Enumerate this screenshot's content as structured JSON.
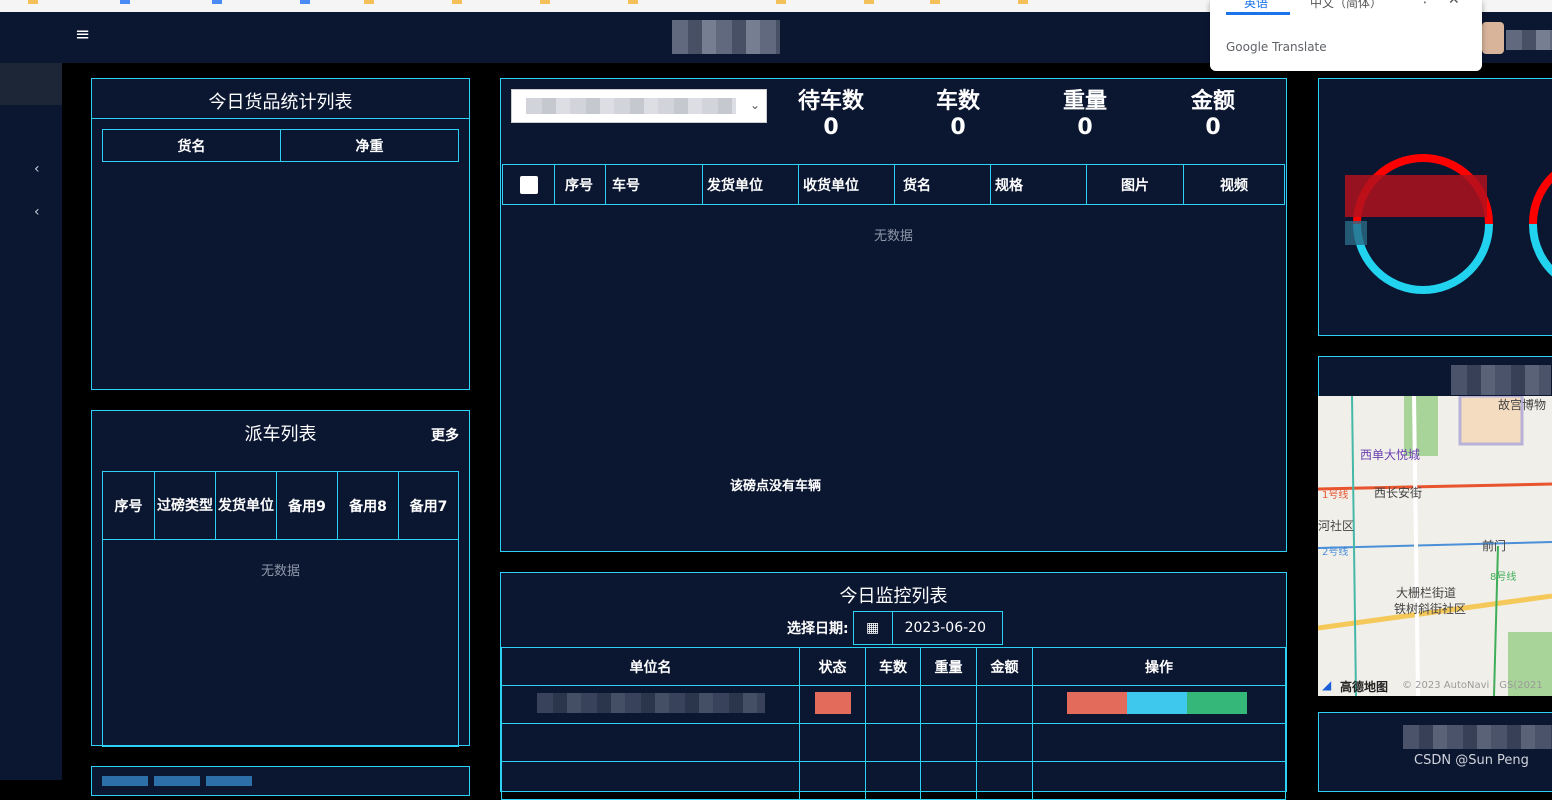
{
  "translate_popup": {
    "tab_english": "英语",
    "tab_chinese": "中文（简体）",
    "brand_google": "Google",
    "brand_translate": "Translate"
  },
  "goods_panel": {
    "title": "今日货品统计列表",
    "columns": [
      "货名",
      "净重"
    ]
  },
  "dispatch_panel": {
    "title": "派车列表",
    "more_link": "更多",
    "columns": [
      "序号",
      "过磅类型",
      "发货单位",
      "备用9",
      "备用8",
      "备用7"
    ],
    "empty_text": "无数据"
  },
  "vehicle_panel": {
    "stats": [
      {
        "label": "待车数",
        "value": "0"
      },
      {
        "label": "车数",
        "value": "0"
      },
      {
        "label": "重量",
        "value": "0"
      },
      {
        "label": "金额",
        "value": "0"
      }
    ],
    "columns": [
      "序号",
      "车号",
      "发货单位",
      "收货单位",
      "货名",
      "规格",
      "图片",
      "视频"
    ],
    "empty_text": "无数据",
    "no_vehicle_text": "该磅点没有车辆"
  },
  "monitor_panel": {
    "title": "今日监控列表",
    "date_label": "选择日期:",
    "date_value": "2023-06-20",
    "columns": [
      "单位名",
      "状态",
      "车数",
      "重量",
      "金额",
      "操作"
    ]
  },
  "map": {
    "labels": [
      "故宫博物",
      "西单大悦城",
      "1号线",
      "西长安街",
      "河社区",
      "前门",
      "2号线",
      "8号线",
      "大栅栏街道",
      "铁树斜街社区"
    ],
    "brand": "高德地图",
    "copyright": "© 2023 AutoNavi - GS(2021"
  },
  "watermark": "CSDN @Sun  Peng",
  "colors": {
    "page_bg": "#000000",
    "panel_bg": "#0b1631",
    "border_cyan": "#2fd0f5",
    "gauge_red": "#ff0000",
    "gauge_cyan": "#22d3f0"
  }
}
